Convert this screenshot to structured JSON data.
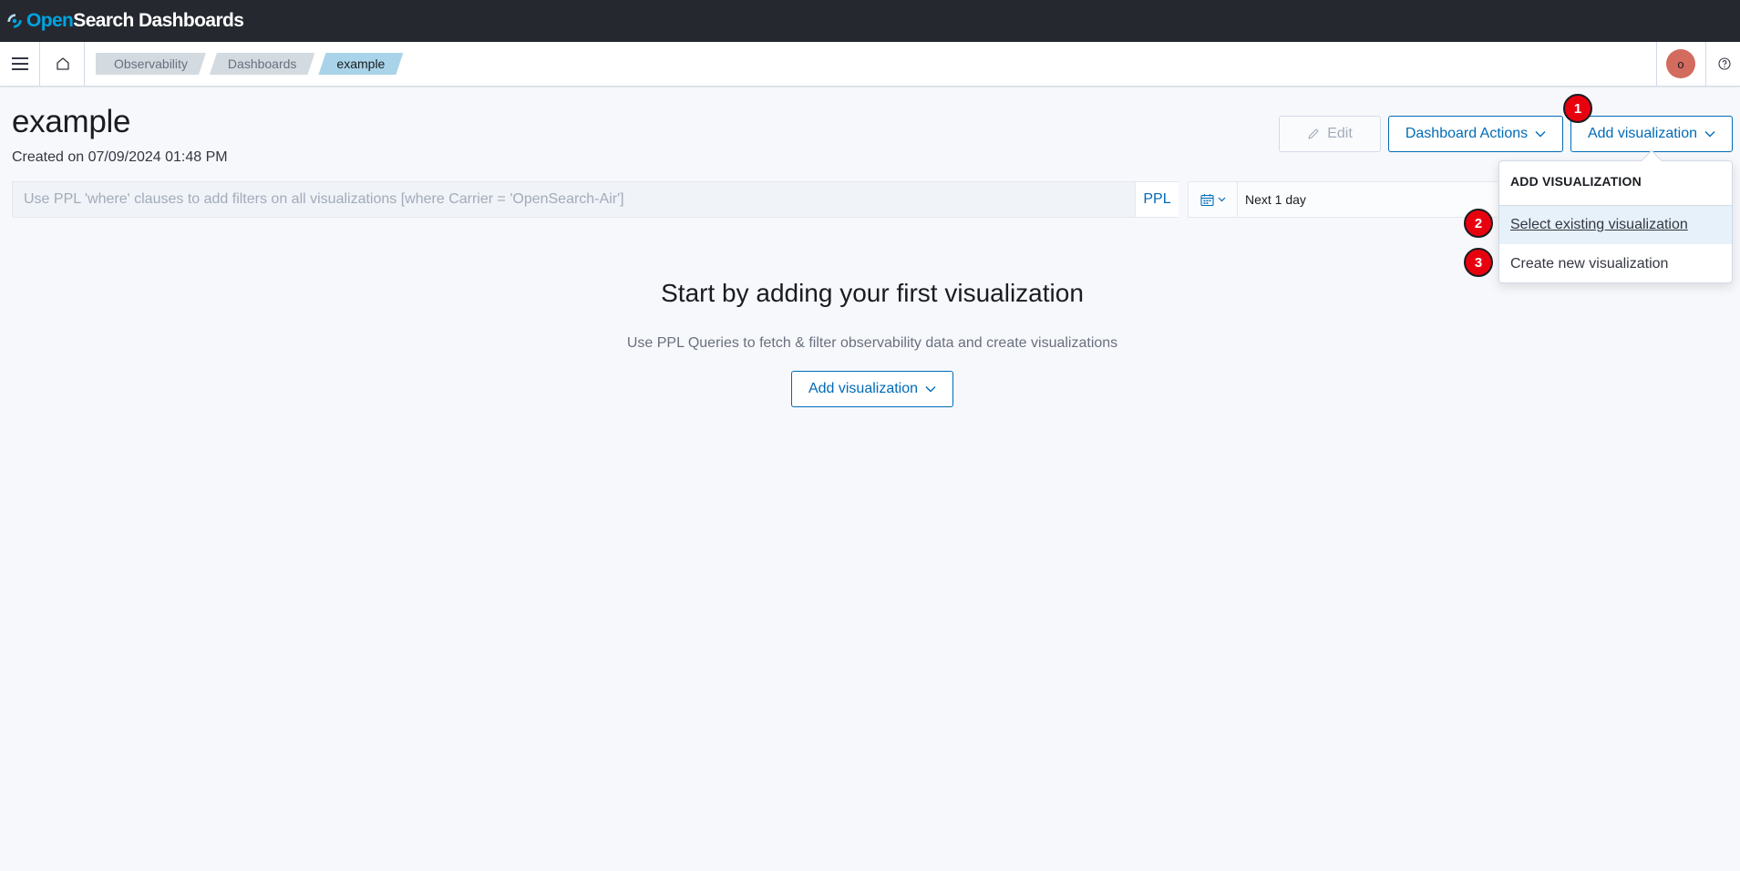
{
  "app": {
    "logo_open": "Open",
    "logo_rest": "Search Dashboards"
  },
  "breadcrumbs": [
    "Observability",
    "Dashboards",
    "example"
  ],
  "user": {
    "avatar_initial": "o"
  },
  "page": {
    "title": "example",
    "created": "Created on 07/09/2024 01:48 PM"
  },
  "toolbar": {
    "edit_label": "Edit",
    "actions_label": "Dashboard Actions",
    "add_vis_label": "Add visualization"
  },
  "search": {
    "placeholder": "Use PPL 'where' clauses to add filters on all visualizations [where Carrier = 'OpenSearch-Air']",
    "language": "PPL"
  },
  "date": {
    "range": "Next 1 day"
  },
  "empty_state": {
    "title": "Start by adding your first visualization",
    "description": "Use PPL Queries to fetch & filter observability data and create visualizations",
    "button_label": "Add visualization"
  },
  "dropdown": {
    "title": "ADD VISUALIZATION",
    "items": [
      "Select existing visualization",
      "Create new visualization"
    ]
  },
  "markers": [
    "1",
    "2",
    "3"
  ],
  "colors": {
    "header_bg": "#25282f",
    "accent": "#006bb8",
    "marker": "#e8000f"
  },
  "icons": [
    "opensearch-logo-icon",
    "menu-icon",
    "home-icon",
    "help-icon",
    "pencil-icon",
    "chevron-down-icon",
    "calendar-icon"
  ]
}
